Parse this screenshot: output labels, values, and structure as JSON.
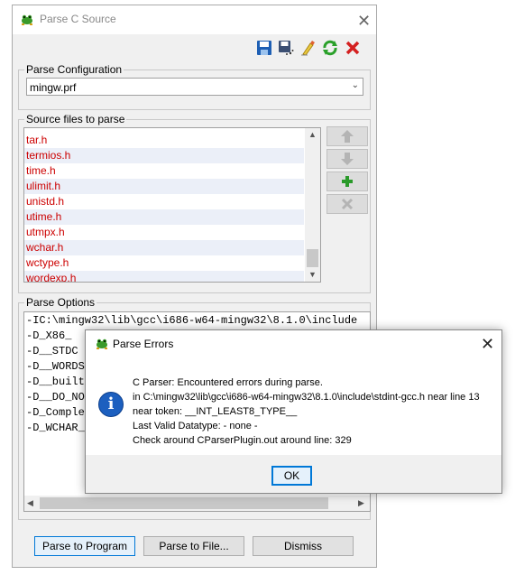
{
  "main_window": {
    "title": "Parse C Source",
    "close_glyph": "✕"
  },
  "toolbar": {
    "icons": [
      "save-icon",
      "save-as-icon",
      "clean-icon",
      "refresh-icon",
      "delete-icon"
    ]
  },
  "parse_configuration": {
    "group_label": "Parse Configuration",
    "selected": "mingw.prf"
  },
  "source_files": {
    "group_label": "Source files to parse",
    "items": [
      "tar.h",
      "termios.h",
      "time.h",
      "ulimit.h",
      "unistd.h",
      "utime.h",
      "utmpx.h",
      "wchar.h",
      "wctype.h",
      "wordexp.h"
    ],
    "buttons": [
      "move-up-icon",
      "move-down-icon",
      "add-icon",
      "remove-icon"
    ]
  },
  "parse_options": {
    "group_label": "Parse Options",
    "lines": [
      "-IC:\\mingw32\\lib\\gcc\\i686-w64-mingw32\\8.1.0\\include",
      "-D_X86_",
      "-D__STDC",
      "-D__WORDSI",
      "-D__builti",
      "-D__DO_NOT",
      "-D_Complex",
      "-D_WCHAR_T"
    ]
  },
  "bottom_buttons": {
    "parse_to_program": "Parse to Program",
    "parse_to_file": "Parse to File...",
    "dismiss": "Dismiss"
  },
  "dialog": {
    "title": "Parse Errors",
    "close_glyph": "✕",
    "info_glyph": "i",
    "lines": [
      "C Parser:  Encountered errors during parse.",
      "in C:\\mingw32\\lib\\gcc\\i686-w64-mingw32\\8.1.0\\include\\stdint-gcc.h near line 13",
      "near token: __INT_LEAST8_TYPE__",
      "Last Valid Datatype: - none -",
      "Check around CParserPlugin.out around line: 329"
    ],
    "ok_label": "OK"
  }
}
